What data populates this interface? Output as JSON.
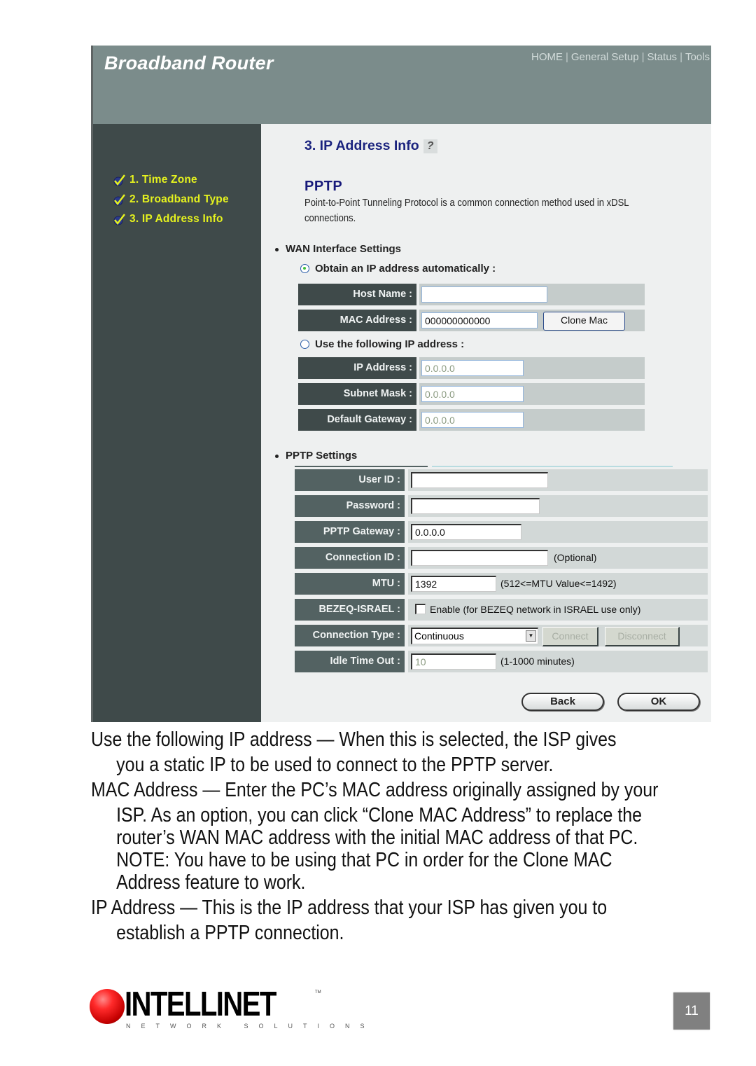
{
  "router_ui": {
    "brand": "Broadband Router",
    "top_nav": [
      "HOME",
      "General Setup",
      "Status",
      "Tools"
    ],
    "steps": [
      {
        "label": "1. Time Zone",
        "done": true
      },
      {
        "label": "2. Broadband Type",
        "done": true
      },
      {
        "label": "3. IP Address Info",
        "done": true
      }
    ],
    "page_title": "3. IP Address Info",
    "help_icon": "help-icon",
    "protocol_title": "PPTP",
    "protocol_desc": "Point-to-Point Tunneling Protocol is a common connection method used in xDSL connections.",
    "wan": {
      "section_label": "WAN Interface Settings",
      "obtain_auto_label": "Obtain an IP address automatically :",
      "obtain_auto_selected": true,
      "host_name_label": "Host Name :",
      "host_name_value": "",
      "mac_label": "MAC Address :",
      "mac_value": "000000000000",
      "clone_mac_button": "Clone Mac",
      "use_following_label": "Use the following IP address :",
      "use_following_selected": false,
      "ip_label": "IP Address :",
      "ip_value": "0.0.0.0",
      "subnet_label": "Subnet Mask :",
      "subnet_value": "0.0.0.0",
      "gateway_label": "Default Gateway :",
      "gateway_value": "0.0.0.0"
    },
    "pptp": {
      "section_label": "PPTP Settings",
      "user_id_label": "User ID :",
      "user_id_value": "",
      "password_label": "Password :",
      "password_value": "",
      "pptp_gateway_label": "PPTP Gateway :",
      "pptp_gateway_value": "0.0.0.0",
      "connection_id_label": "Connection ID :",
      "connection_id_value": "",
      "connection_id_hint": "(Optional)",
      "mtu_label": "MTU :",
      "mtu_value": "1392",
      "mtu_hint": "(512<=MTU Value<=1492)",
      "bezeq_label": "BEZEQ-ISRAEL :",
      "bezeq_checkbox_label": "Enable (for BEZEQ network in ISRAEL use only)",
      "bezeq_checked": false,
      "connection_type_label": "Connection Type :",
      "connection_type_value": "Continuous",
      "connect_button": "Connect",
      "disconnect_button": "Disconnect",
      "idle_label": "Idle Time Out :",
      "idle_value": "10",
      "idle_hint": "(1-1000 minutes)"
    },
    "back_button": "Back",
    "ok_button": "OK"
  },
  "document": {
    "paragraphs": [
      {
        "first": "Use the following IP address — When this is selected, the ISP gives",
        "cont": [
          "you a static IP to be used to connect to the PPTP server."
        ]
      },
      {
        "first": "MAC Address — Enter the PC’s MAC address originally assigned by your",
        "cont": [
          "ISP. As an option, you can click “Clone MAC Address” to replace the",
          "router’s WAN MAC address with the initial MAC address of that PC.",
          "NOTE: You have to be using that PC in order for the Clone MAC",
          "Address feature to work."
        ]
      },
      {
        "first": "IP Address — This is the IP address that your ISP has given you to",
        "cont": [
          "establish a PPTP connection."
        ]
      }
    ]
  },
  "footer": {
    "logo_text": "INTELLINET",
    "logo_tagline": "NETWORK SOLUTIONS",
    "page_number": "11"
  },
  "colors": {
    "header_bg": "#7b8c8b",
    "sidebar_bg": "#3f4a4a",
    "step_text": "#e5f21e",
    "title_text": "#1a237e",
    "content_bg": "#eef0f0"
  }
}
